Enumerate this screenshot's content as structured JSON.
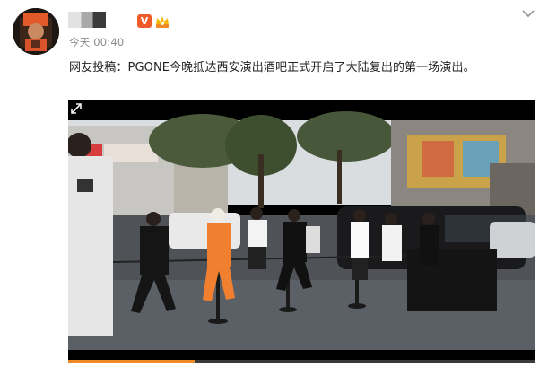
{
  "post": {
    "time": "今天 00:40",
    "text": "网友投稿：PGONE今晚抵达西安演出酒吧正式开启了大陆复出的第一场演出。"
  },
  "badges": {
    "vip": "V"
  },
  "video": {
    "progress_fraction": 0.27
  },
  "icons": {
    "more": "chevron-down-icon",
    "expand": "expand-icon",
    "vip": "vip-icon",
    "level": "level-icon"
  },
  "colors": {
    "vip_badge": "#f05a28",
    "progress": "#f08a24",
    "text": "#222222",
    "meta": "#8c8c8c"
  }
}
